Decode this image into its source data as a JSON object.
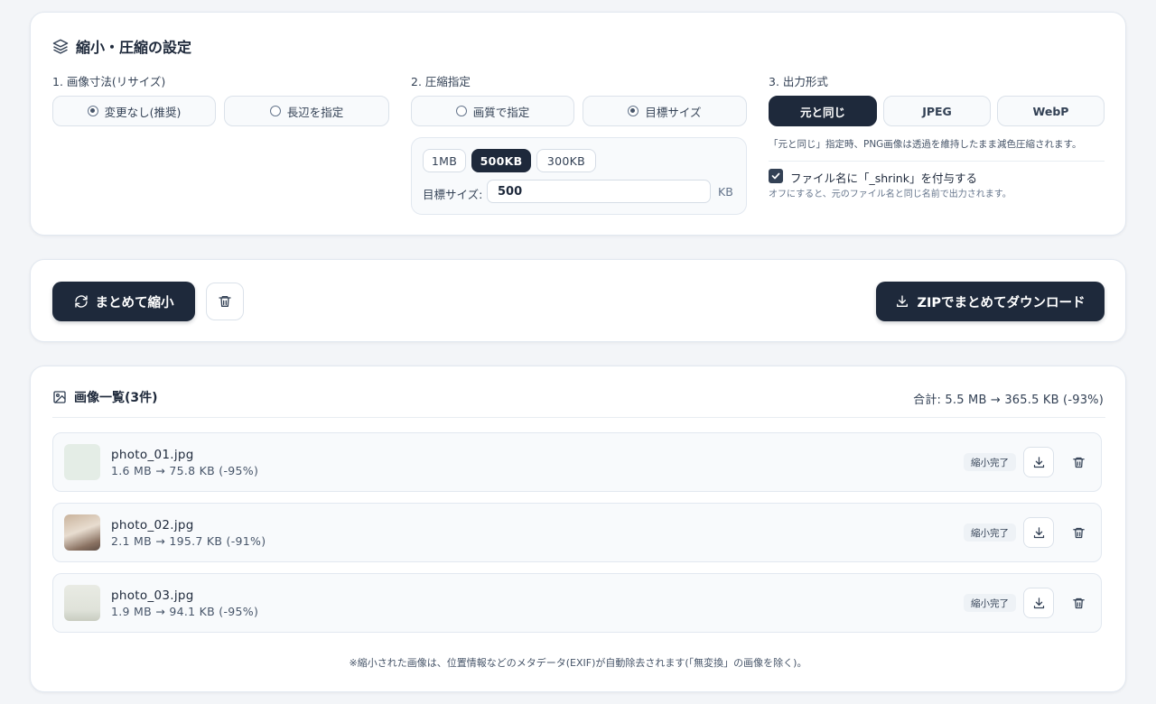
{
  "settings": {
    "title": "縮小・圧縮の設定",
    "resize": {
      "label": "1. 画像寸法(リサイズ)",
      "options": [
        "変更なし(推奨)",
        "長辺を指定"
      ],
      "selected": "変更なし(推奨)"
    },
    "compress": {
      "label": "2. 圧縮指定",
      "options": [
        "画質で指定",
        "目標サイズ"
      ],
      "selected": "目標サイズ",
      "presets": [
        "1MB",
        "500KB",
        "300KB"
      ],
      "selected_preset": "500KB",
      "target_label": "目標サイズ:",
      "target_value": "500",
      "target_unit": "KB"
    },
    "format": {
      "label": "3. 出力形式",
      "options": [
        "元と同じ",
        "JPEG",
        "WebP"
      ],
      "selected": "元と同じ",
      "note": "「元と同じ」指定時、PNG画像は透過を維持したまま減色圧縮されます。",
      "suffix_label": "ファイル名に「_shrink」を付与する",
      "suffix_checked": true,
      "suffix_note": "オフにすると、元のファイル名と同じ名前で出力されます。"
    }
  },
  "actions": {
    "shrink_all": "まとめて縮小",
    "zip_download": "ZIPでまとめてダウンロード"
  },
  "list": {
    "title": "画像一覧(3件)",
    "total": "合計: 5.5 MB → 365.5 KB (-93%)",
    "items": [
      {
        "name": "photo_01.jpg",
        "size": "1.6 MB → 75.8 KB (-95%)",
        "status": "縮小完了"
      },
      {
        "name": "photo_02.jpg",
        "size": "2.1 MB → 195.7 KB (-91%)",
        "status": "縮小完了"
      },
      {
        "name": "photo_03.jpg",
        "size": "1.9 MB → 94.1 KB (-95%)",
        "status": "縮小完了"
      }
    ],
    "footer": "※縮小された画像は、位置情報などのメタデータ(EXIF)が自動除去されます(「無変換」の画像を除く)。"
  },
  "colors": {
    "primary": "#1e293b",
    "background": "#f3f5f8",
    "card": "#ffffff",
    "border": "#e2e8f0"
  }
}
